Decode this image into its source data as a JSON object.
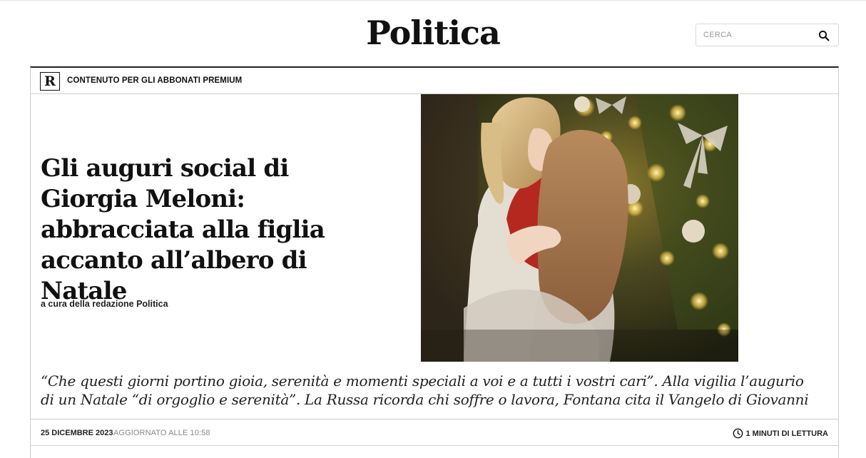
{
  "header": {
    "section_title": "Politica",
    "search": {
      "placeholder": "CERCA",
      "value": ""
    }
  },
  "article": {
    "premium_logo": "R",
    "premium_label": "CONTENUTO PER GLI ABBONATI PREMIUM",
    "headline": "Gli auguri social di Giorgia Meloni: abbracciata alla figlia accanto all’albero di Natale",
    "byline": "a cura della redazione Politica",
    "summary": "“Che questi giorni portino gioia, serenità e momenti speciali a voi e a tutti i vostri cari”. Alla vigilia l’augurio di un Natale “di orgoglio e serenità”. La Russa ricorda chi soffre o lavora, Fontana cita il Vangelo di Giovanni",
    "date": "25 DICEMBRE 2023",
    "updated": "AGGIORNATO ALLE 10:58",
    "reading_time": "1 MINUTI DI LETTURA",
    "image_icon": "photo-woman-hugging-child-christmas-tree"
  },
  "colors": {
    "text": "#111111",
    "border": "#cfcfcf",
    "muted": "#888888"
  }
}
